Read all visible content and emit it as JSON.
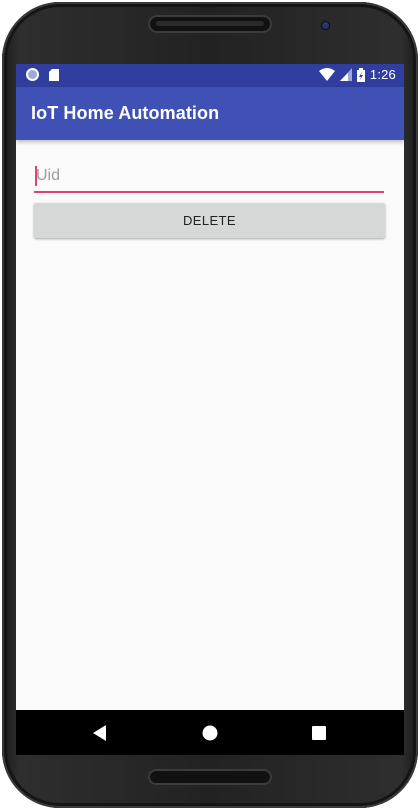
{
  "status_bar": {
    "time": "1:26",
    "icons": [
      "ring-icon",
      "sd-card-icon",
      "wifi-icon",
      "signal-icon",
      "battery-charging-icon"
    ]
  },
  "app_bar": {
    "title": "IoT Home Automation"
  },
  "form": {
    "uid_placeholder": "Uid",
    "uid_value": "",
    "delete_label": "DELETE"
  },
  "nav_bar": {
    "icons": [
      "back-icon",
      "home-icon",
      "recents-icon"
    ]
  },
  "colors": {
    "primary": "#3f51b5",
    "primary_dark": "#303f9f",
    "accent": "#e0407a",
    "background": "#fafafa",
    "button": "#d6d7d7"
  }
}
